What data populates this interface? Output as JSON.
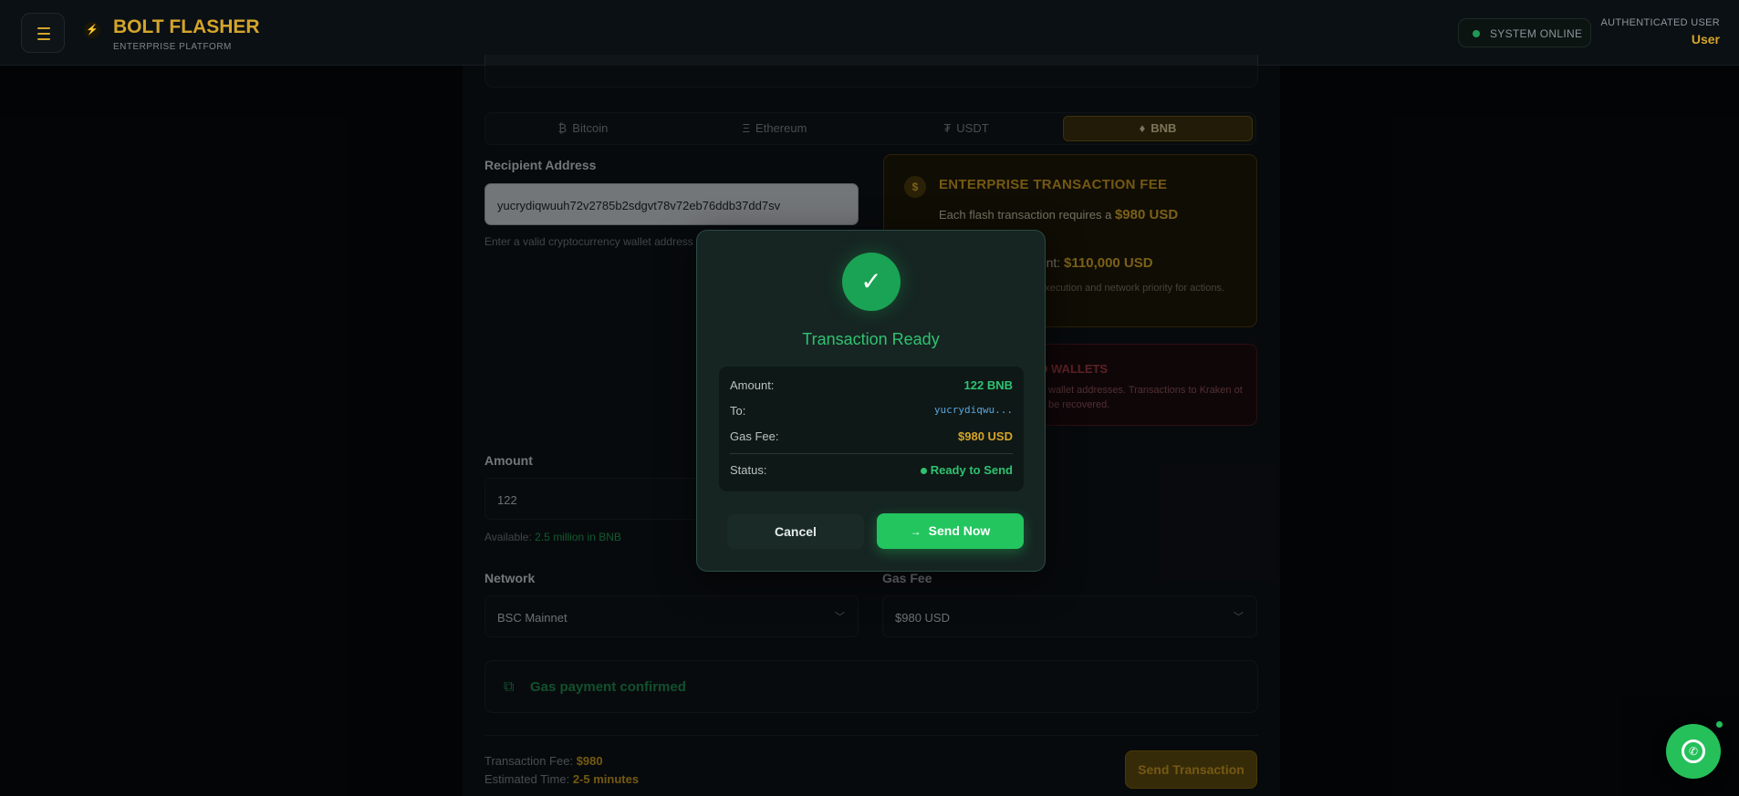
{
  "header": {
    "brand_title": "BOLT FLASHER",
    "brand_subtitle": "ENTERPRISE PLATFORM",
    "status": "SYSTEM ONLINE",
    "auth_label": "AUTHENTICATED USER",
    "auth_user": "User"
  },
  "tabs": [
    {
      "glyph": "₿",
      "label": "Bitcoin"
    },
    {
      "glyph": "Ξ",
      "label": "Ethereum"
    },
    {
      "glyph": "₮",
      "label": "USDT"
    },
    {
      "glyph": "♦",
      "label": "BNB",
      "active": true
    }
  ],
  "form": {
    "recipient_label": "Recipient Address",
    "recipient_value": "yucrydiqwuuh72v2785b2sdgvt78v72eb76ddb37dd7sv",
    "recipient_hint": "Enter a valid cryptocurrency wallet address",
    "amount_label": "Amount",
    "amount_value": "122",
    "available_prefix": "Available:",
    "available_value": "2.5 million in BNB",
    "network_label": "Network",
    "network_value": "BSC Mainnet",
    "gasfee_label": "Gas Fee",
    "gasfee_value": "$980 USD"
  },
  "fee_card": {
    "icon": "$",
    "title": "ENTERPRISE TRANSACTION FEE",
    "text_prefix": "Each flash transaction requires a",
    "text_amount": "$980 USD",
    "min_prefix": "ount:",
    "min_amount": "$110,000 USD",
    "note": "execution and network priority for actions."
  },
  "warning_card": {
    "title": "CTED WALLETS",
    "text": "wallet addresses. Transactions to Kraken ot be recovered."
  },
  "confirm": {
    "text": "Gas payment confirmed"
  },
  "footer": {
    "fee_label": "Transaction Fee:",
    "fee_value": "$980",
    "time_label": "Estimated Time:",
    "time_value": "2-5 minutes",
    "send_button": "Send Transaction"
  },
  "modal": {
    "title": "Transaction Ready",
    "amount_label": "Amount:",
    "amount_value": "122 BNB",
    "to_label": "To:",
    "to_value": "yucrydiqwu...",
    "gas_label": "Gas Fee:",
    "gas_value": "$980 USD",
    "status_label": "Status:",
    "status_value": "Ready to Send",
    "cancel": "Cancel",
    "send_now": "Send Now"
  },
  "colors": {
    "accent_gold": "#d4a52a",
    "success_green": "#22c55e",
    "danger_red": "#a03a3f"
  },
  "icons": [
    "menu-icon",
    "bolt-icon",
    "status-dot-icon",
    "check-icon",
    "external-link-icon",
    "chevron-down-icon",
    "arrow-right-icon",
    "whatsapp-icon"
  ]
}
